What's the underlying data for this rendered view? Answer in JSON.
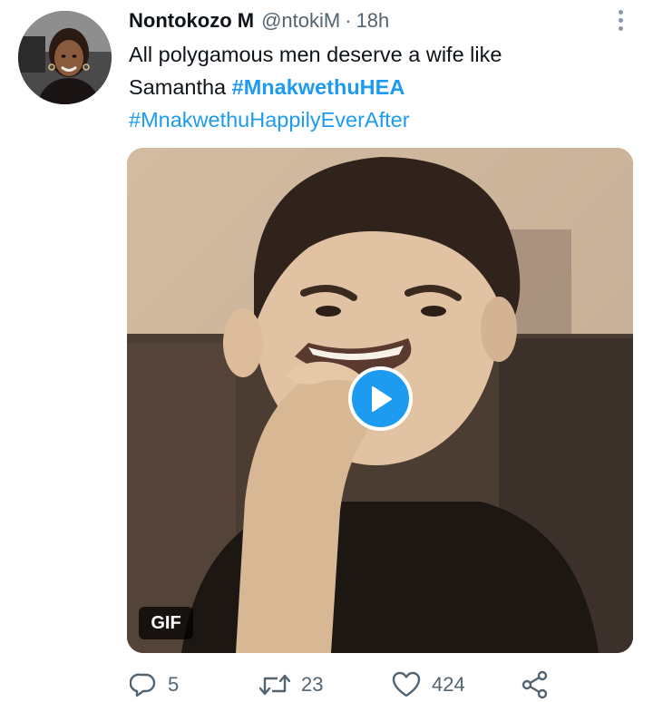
{
  "tweet": {
    "author": {
      "display_name": "Nontokozo M",
      "handle": "@ntokiM",
      "separator": "·",
      "time": "18h"
    },
    "text": {
      "line1": "All polygamous men deserve a wife like",
      "line2_prefix": "Samantha ",
      "hashtag1": "#MnakwethuHEA",
      "hashtag2": "#MnakwethuHappilyEverAfter"
    },
    "media": {
      "type_badge": "GIF",
      "play_icon": "play-icon"
    },
    "actions": {
      "reply_count": "5",
      "retweet_count": "23",
      "like_count": "424",
      "reply_icon": "reply-icon",
      "retweet_icon": "retweet-icon",
      "like_icon": "heart-icon",
      "share_icon": "share-icon"
    }
  },
  "colors": {
    "accent": "#1d9bf0",
    "text_primary": "#0f1419",
    "text_secondary": "#536471"
  }
}
